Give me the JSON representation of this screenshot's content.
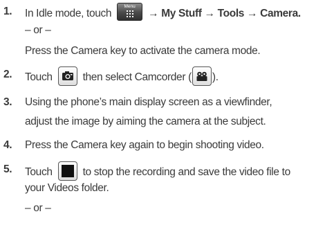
{
  "steps": [
    {
      "number": "1.",
      "pre": "In Idle mode, touch",
      "menu_icon_label": "Menu",
      "post": "→ My Stuff → Tools → Camera.",
      "or": "– or –",
      "alt": "Press the Camera key to activate the camera mode."
    },
    {
      "number": "2.",
      "pre": "Touch",
      "post_a": "then select Camcorder (",
      "post_b": ")."
    },
    {
      "number": "3.",
      "line1": "Using the phone’s main display screen as a viewfinder,",
      "line2": "adjust the image by aiming the camera at the subject."
    },
    {
      "number": "4.",
      "text": "Press the Camera key again to begin shooting video."
    },
    {
      "number": "5.",
      "pre": "Touch",
      "post": "to stop the recording and save the video file to",
      "line2": "your Videos folder.",
      "or": "– or –"
    }
  ],
  "icons": {
    "menu": "menu-grid-icon",
    "camera": "camera-icon",
    "camcorder": "camcorder-icon",
    "stop": "stop-icon"
  }
}
